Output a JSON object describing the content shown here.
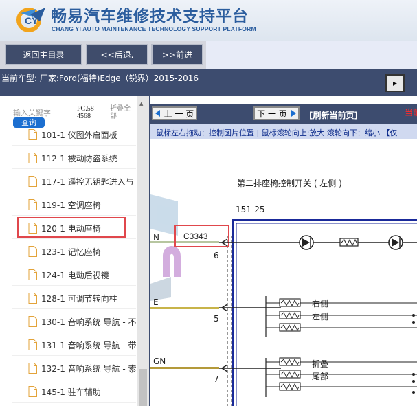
{
  "header": {
    "title": "畅易汽车维修技术支持平台",
    "subtitle": "CHANG YI AUTO MAINTENANCE TECHNOLOGY SUPPORT PLATFORM",
    "logo_icon": "cy-logo-icon",
    "brand_color": "#2b5d9e"
  },
  "nav": {
    "home_label": "返回主目录",
    "back_label": "<<后退.",
    "forward_label": ">>前进"
  },
  "vehicle": {
    "text": "当前车型:  厂家:Ford(福特)Edge（锐界）2015-2016"
  },
  "search": {
    "keyword_label": "输入关键字",
    "query_label": "查询",
    "pc_code": "PC.58-4568",
    "fold_all": "折叠全部"
  },
  "tree": {
    "items": [
      {
        "label": "101-1 仪图外启面板"
      },
      {
        "label": "112-1 被动防盗系统"
      },
      {
        "label": "117-1 遥控无钥匙进入与"
      },
      {
        "label": "119-1 空调座椅"
      },
      {
        "label": "120-1 电动座椅"
      },
      {
        "label": "123-1 记忆座椅"
      },
      {
        "label": "124-1 电动后视镜"
      },
      {
        "label": "128-1 可调节转向柱"
      },
      {
        "label": "130-1 音响系统 导航 - 不"
      },
      {
        "label": "131-1 音响系统 导航 - 带"
      },
      {
        "label": "132-1 音响系统 导航 - 索"
      },
      {
        "label": "145-1 驻车辅助"
      }
    ],
    "selected_index": 4,
    "highlight_color": "#e0474c"
  },
  "viewer": {
    "prev_label": "上 一 页",
    "next_label": "下 一 页",
    "refresh_label": "[刷新当前页]",
    "current_label": "当前",
    "hint": "鼠标左右拖动：控制图片位置 | 鼠标滚轮向上:放大   滚轮向下：缩小 【仅",
    "diagram": {
      "title": "第二排座椅控制开关 ( 左侧 )",
      "page_ref": "151-25",
      "connector": "C3343",
      "pins": [
        "6",
        "5",
        "7"
      ],
      "wire_tags": [
        "N",
        "E",
        "GN"
      ],
      "labels": [
        "右侧",
        "左侧",
        "折叠",
        "尾部"
      ]
    }
  }
}
